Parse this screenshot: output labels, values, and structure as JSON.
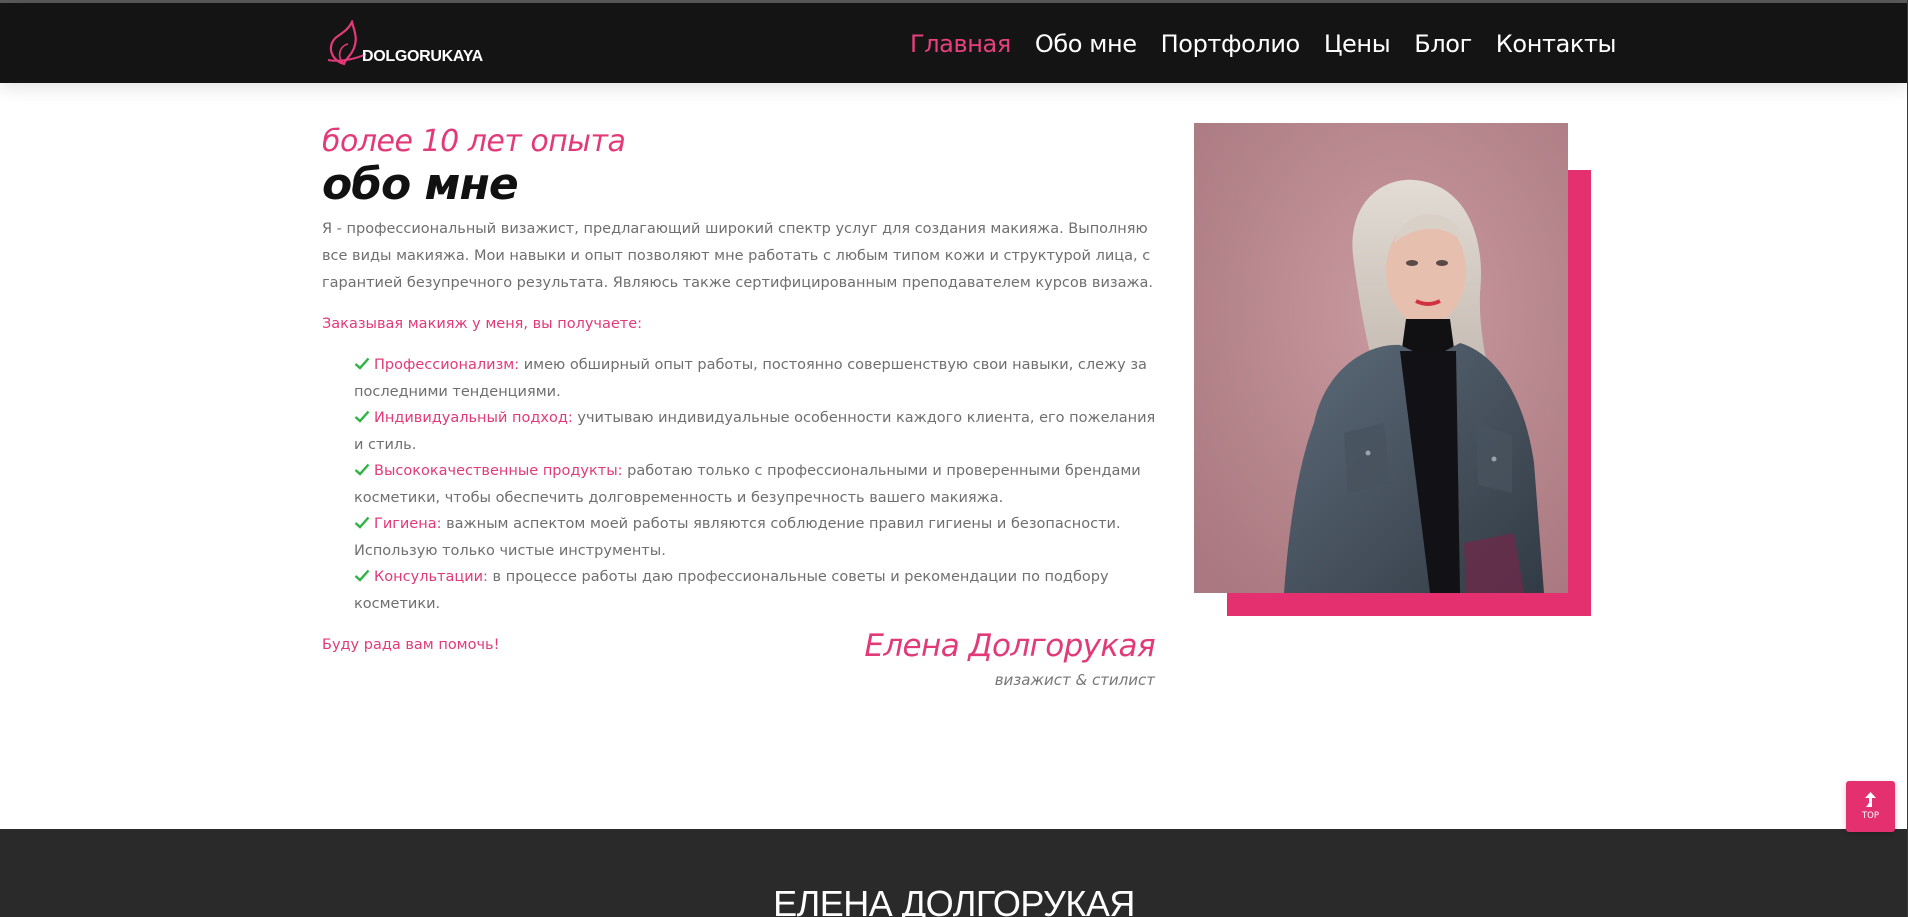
{
  "brand": {
    "logo_text": "DOLGORUKAYA"
  },
  "nav": {
    "items": [
      {
        "label": "Главная",
        "active": true
      },
      {
        "label": "Обо мне",
        "active": false
      },
      {
        "label": "Портфолио",
        "active": false
      },
      {
        "label": "Цены",
        "active": false
      },
      {
        "label": "Блог",
        "active": false
      },
      {
        "label": "Контакты",
        "active": false
      }
    ]
  },
  "about": {
    "kicker": "более 10 лет опыта",
    "title": "обо мне",
    "intro": "Я - профессиональный визажист, предлагающий широкий спектр услуг для создания макияжа. Выполняю все виды макияжа. Мои навыки и опыт позволяют мне работать с любым типом кожи и структурой лица, с гарантией безупречного результата. Являюсь также сертифицированным преподавателем курсов визажа.",
    "lead": "Заказывая макияж у меня, вы получаете:",
    "benefits": [
      {
        "name": "Профессионализм:",
        "text": " имею обширный опыт работы, постоянно совершенствую свои навыки, слежу за последними тенденциями."
      },
      {
        "name": "Индивидуальный подход:",
        "text": " учитываю индивидуальные особенности каждого клиента, его пожелания и стиль."
      },
      {
        "name": "Высококачественные продукты:",
        "text": " работаю только с профессиональными и проверенными брендами косметики, чтобы обеспечить долговременность и безупречность вашего макияжа."
      },
      {
        "name": "Гигиена:",
        "text": " важным аспектом моей работы являются соблюдение правил гигиены и безопасности. Использую только чистые инструменты."
      },
      {
        "name": "Консультации:",
        "text": " в процессе работы даю профессиональные советы и рекомендации по подбору косметики."
      }
    ],
    "closing": "Буду рада вам помочь!",
    "signature_name": "Елена Долгорукая",
    "signature_role": "визажист & стилист"
  },
  "footer": {
    "title": "ЕЛЕНА ДОЛГОРУКАЯ"
  },
  "scroll_top": {
    "label": "TOP"
  },
  "colors": {
    "accent": "#e5306f",
    "header_bg": "#141414",
    "footer_bg": "#2a2a2a",
    "check": "#2fb344"
  }
}
